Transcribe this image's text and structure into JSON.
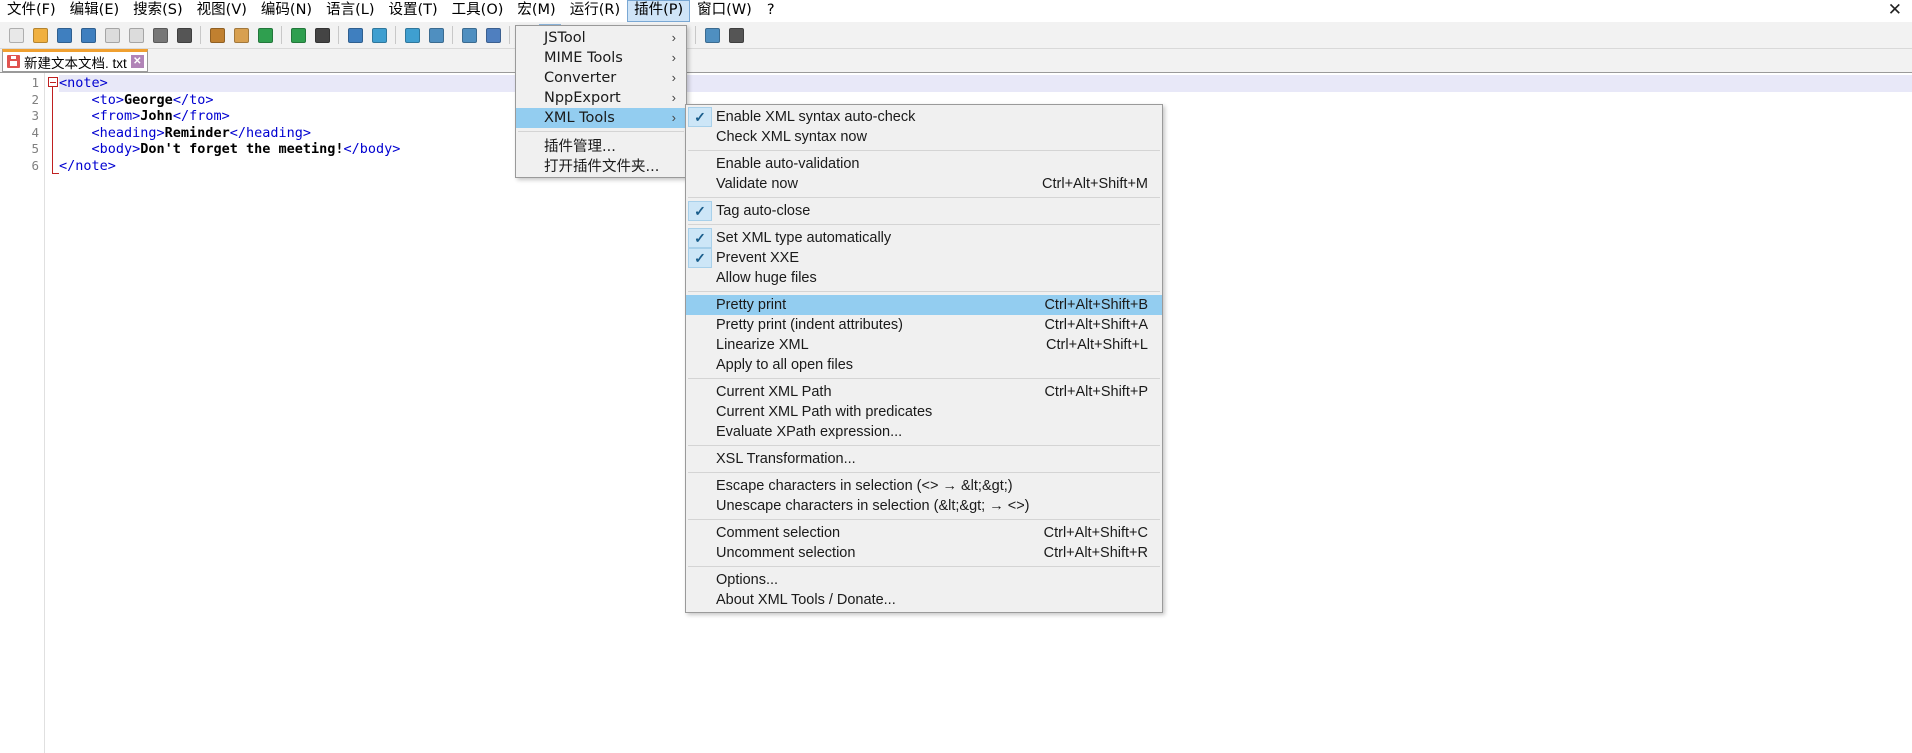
{
  "window": {
    "close_label": "✕"
  },
  "menubar": {
    "items": [
      {
        "label": "文件(F)",
        "active": false
      },
      {
        "label": "编辑(E)",
        "active": false
      },
      {
        "label": "搜索(S)",
        "active": false
      },
      {
        "label": "视图(V)",
        "active": false
      },
      {
        "label": "编码(N)",
        "active": false
      },
      {
        "label": "语言(L)",
        "active": false
      },
      {
        "label": "设置(T)",
        "active": false
      },
      {
        "label": "工具(O)",
        "active": false
      },
      {
        "label": "宏(M)",
        "active": false
      },
      {
        "label": "运行(R)",
        "active": false
      },
      {
        "label": "插件(P)",
        "active": true
      },
      {
        "label": "窗口(W)",
        "active": false
      },
      {
        "label": "?",
        "active": false
      }
    ]
  },
  "toolbar": {
    "buttons": [
      "new-file-icon",
      "open-file-icon",
      "save-icon",
      "save-all-icon",
      "close-file-icon",
      "close-all-icon",
      "print-icon",
      "cut-icon",
      "copy-icon",
      "paste-icon",
      "undo-icon",
      "redo-icon",
      "find-icon",
      "replace-icon",
      "zoom-in-icon",
      "zoom-out-icon",
      "sync-vertical-icon",
      "sync-horizontal-icon",
      "word-wrap-icon",
      "show-all-chars-icon",
      "indent-guide-icon",
      "user-defined-dialog-icon",
      "show-doc-map-icon",
      "function-list-icon",
      "folder-as-workspace-icon",
      "macro-record-icon",
      "macro-play-icon",
      "macro-save-icon"
    ]
  },
  "tab": {
    "name": "新建文本文档. txt",
    "close_label": "✕",
    "icon": "save-disk-icon"
  },
  "editor": {
    "line_numbers": [
      "1",
      "2",
      "3",
      "4",
      "5",
      "6"
    ],
    "lines": [
      {
        "indent": 0,
        "segments": [
          {
            "t": "<note>",
            "k": "tag"
          }
        ]
      },
      {
        "indent": 4,
        "segments": [
          {
            "t": "<to>",
            "k": "tag"
          },
          {
            "t": "George",
            "k": "txt"
          },
          {
            "t": "</to>",
            "k": "tag"
          }
        ]
      },
      {
        "indent": 4,
        "segments": [
          {
            "t": "<from>",
            "k": "tag"
          },
          {
            "t": "John",
            "k": "txt"
          },
          {
            "t": "</from>",
            "k": "tag"
          }
        ]
      },
      {
        "indent": 4,
        "segments": [
          {
            "t": "<heading>",
            "k": "tag"
          },
          {
            "t": "Reminder",
            "k": "txt"
          },
          {
            "t": "</heading>",
            "k": "tag"
          }
        ]
      },
      {
        "indent": 4,
        "segments": [
          {
            "t": "<body>",
            "k": "tag"
          },
          {
            "t": "Don't forget the meeting!",
            "k": "txt"
          },
          {
            "t": "</body>",
            "k": "tag"
          }
        ]
      },
      {
        "indent": 0,
        "segments": [
          {
            "t": "</note>",
            "k": "tag"
          }
        ]
      }
    ]
  },
  "plugins_menu": {
    "items": [
      {
        "label": "JSTool",
        "submenu": true,
        "sep_after": false,
        "highlight": false
      },
      {
        "label": "MIME Tools",
        "submenu": true,
        "sep_after": false,
        "highlight": false
      },
      {
        "label": "Converter",
        "submenu": true,
        "sep_after": false,
        "highlight": false
      },
      {
        "label": "NppExport",
        "submenu": true,
        "sep_after": false,
        "highlight": false
      },
      {
        "label": "XML Tools",
        "submenu": true,
        "sep_after": true,
        "highlight": true
      },
      {
        "label": "插件管理...",
        "submenu": false,
        "sep_after": false,
        "highlight": false
      },
      {
        "label": "打开插件文件夹...",
        "submenu": false,
        "sep_after": false,
        "highlight": false
      }
    ],
    "chevron": "›"
  },
  "xml_tools_menu": {
    "checkmark": "✓",
    "items": [
      {
        "label": "Enable XML syntax auto-check",
        "accel": "",
        "checked": true,
        "highlight": false,
        "sep_after": false
      },
      {
        "label": "Check XML syntax now",
        "accel": "",
        "checked": false,
        "highlight": false,
        "sep_after": true
      },
      {
        "label": "Enable auto-validation",
        "accel": "",
        "checked": false,
        "highlight": false,
        "sep_after": false
      },
      {
        "label": "Validate now",
        "accel": "Ctrl+Alt+Shift+M",
        "checked": false,
        "highlight": false,
        "sep_after": true
      },
      {
        "label": "Tag auto-close",
        "accel": "",
        "checked": true,
        "highlight": false,
        "sep_after": true
      },
      {
        "label": "Set XML type automatically",
        "accel": "",
        "checked": true,
        "highlight": false,
        "sep_after": false
      },
      {
        "label": "Prevent XXE",
        "accel": "",
        "checked": true,
        "highlight": false,
        "sep_after": false
      },
      {
        "label": "Allow huge files",
        "accel": "",
        "checked": false,
        "highlight": false,
        "sep_after": true
      },
      {
        "label": "Pretty print",
        "accel": "Ctrl+Alt+Shift+B",
        "checked": false,
        "highlight": true,
        "sep_after": false
      },
      {
        "label": "Pretty print (indent attributes)",
        "accel": "Ctrl+Alt+Shift+A",
        "checked": false,
        "highlight": false,
        "sep_after": false
      },
      {
        "label": "Linearize XML",
        "accel": "Ctrl+Alt+Shift+L",
        "checked": false,
        "highlight": false,
        "sep_after": false
      },
      {
        "label": "Apply to all open files",
        "accel": "",
        "checked": false,
        "highlight": false,
        "sep_after": true
      },
      {
        "label": "Current XML Path",
        "accel": "Ctrl+Alt+Shift+P",
        "checked": false,
        "highlight": false,
        "sep_after": false
      },
      {
        "label": "Current XML Path with predicates",
        "accel": "",
        "checked": false,
        "highlight": false,
        "sep_after": false
      },
      {
        "label": "Evaluate XPath expression...",
        "accel": "",
        "checked": false,
        "highlight": false,
        "sep_after": true
      },
      {
        "label": "XSL Transformation...",
        "accel": "",
        "checked": false,
        "highlight": false,
        "sep_after": true
      },
      {
        "label": "Escape characters in selection (<> → &lt;&gt;)",
        "accel": "",
        "checked": false,
        "highlight": false,
        "sep_after": false
      },
      {
        "label": "Unescape characters in selection (&lt;&gt; → <>)",
        "accel": "",
        "checked": false,
        "highlight": false,
        "sep_after": true
      },
      {
        "label": "Comment selection",
        "accel": "Ctrl+Alt+Shift+C",
        "checked": false,
        "highlight": false,
        "sep_after": false
      },
      {
        "label": "Uncomment selection",
        "accel": "Ctrl+Alt+Shift+R",
        "checked": false,
        "highlight": false,
        "sep_after": true
      },
      {
        "label": "Options...",
        "accel": "",
        "checked": false,
        "highlight": false,
        "sep_after": false
      },
      {
        "label": "About XML Tools / Donate...",
        "accel": "",
        "checked": false,
        "highlight": false,
        "sep_after": false
      }
    ]
  },
  "colors": {
    "menu_bg": "#f0f0f0",
    "highlight": "#93cdf0",
    "check_bg": "#cde6f7",
    "tag_blue": "#0000d0",
    "tab_orange": "#f0a030",
    "current_line": "#e8e8f8"
  }
}
